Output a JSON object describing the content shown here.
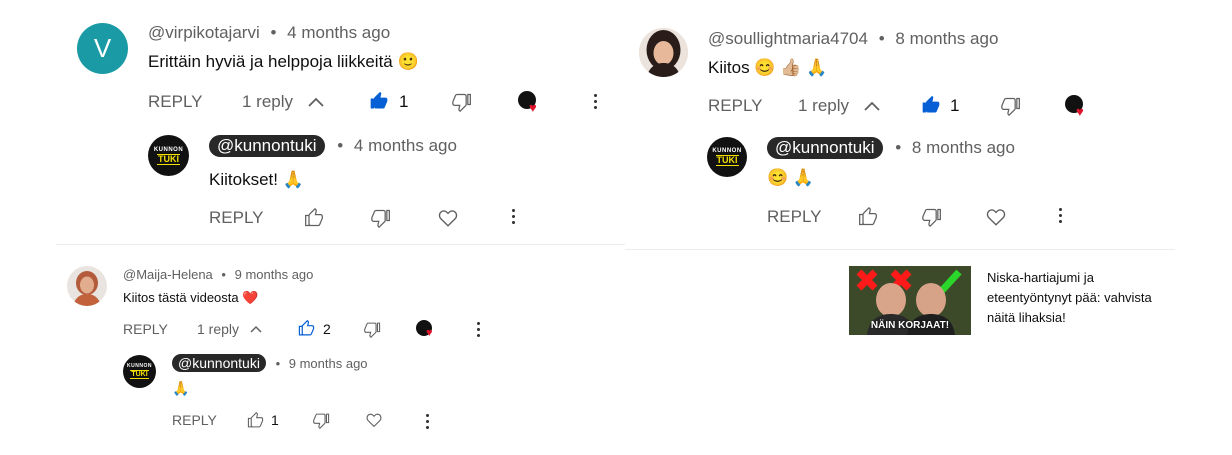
{
  "comments": [
    {
      "avatar_letter": "V",
      "handle": "@virpikotajarvi",
      "time": "4 months ago",
      "text": "Erittäin hyviä ja helppoja liikkeitä 🙂",
      "reply_label": "REPLY",
      "replies_label": "1 reply",
      "likes": "1",
      "reply": {
        "handle": "@kunnontuki",
        "time": "4 months ago",
        "text": "Kiitokset! 🙏",
        "reply_label": "REPLY"
      }
    },
    {
      "handle": "@soullightmaria4704",
      "time": "8 months ago",
      "text": "Kiitos 😊 👍🏼 🙏",
      "reply_label": "REPLY",
      "replies_label": "1 reply",
      "likes": "1",
      "reply": {
        "handle": "@kunnontuki",
        "time": "8 months ago",
        "text": "😊 🙏",
        "reply_label": "REPLY"
      }
    },
    {
      "handle": "@Maija-Helena",
      "time": "9 months ago",
      "text": "Kiitos tästä videosta ❤️",
      "reply_label": "REPLY",
      "replies_label": "1 reply",
      "likes": "2",
      "reply": {
        "handle": "@kunnontuki",
        "time": "9 months ago",
        "text": "🙏",
        "reply_label": "REPLY",
        "likes": "1"
      }
    }
  ],
  "channel_avatar": {
    "top": "KUNNON",
    "bottom": "TUKI"
  },
  "dot": "•",
  "related_video": {
    "thumbnail_text": "NÄIN KORJAAT!",
    "title_line1": "Niska-hartiajumi ja",
    "title_line2": "eteentyöntynyt pää: vahvista",
    "title_line3": "näitä lihaksia!"
  },
  "colors": {
    "like_active": "#065fd4",
    "heart": "#e0142c",
    "avatar_v": "#1a9aa4",
    "chip": "#282828",
    "brand_yellow": "#f3df00"
  }
}
